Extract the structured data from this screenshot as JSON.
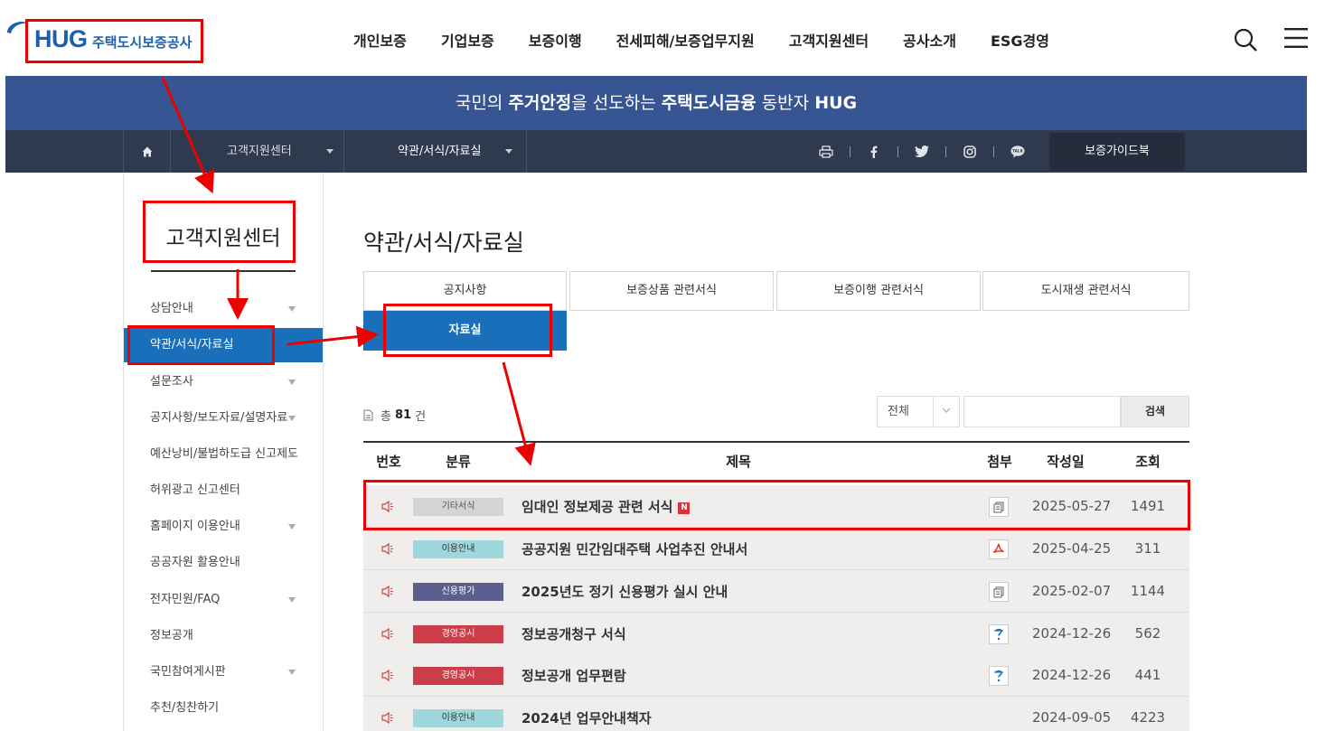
{
  "header": {
    "logo_brand": "HUG",
    "logo_name": "주택도시보증공사",
    "nav": [
      "개인보증",
      "기업보증",
      "보증이행",
      "전세피해/보증업무지원",
      "고객지원센터",
      "공사소개",
      "ESG경영"
    ]
  },
  "banner": {
    "part1": "국민의 ",
    "bold1": "주거안정",
    "part2": "을 선도하는 ",
    "bold2": "주택도시금융",
    "part3": " 동반자 ",
    "bold3": "HUG"
  },
  "location": {
    "depth1": "고객지원센터",
    "depth2": "약관/서식/자료실",
    "guidebook": "보증가이드북"
  },
  "sidebar": {
    "title": "고객지원센터",
    "items": [
      {
        "label": "상담안내",
        "has_arrow": true
      },
      {
        "label": "약관/서식/자료실",
        "active": true
      },
      {
        "label": "설문조사",
        "has_arrow": true
      },
      {
        "label": "공지사항/보도자료/설명자료",
        "has_arrow": true
      },
      {
        "label": "예산낭비/불법하도급 신고제도",
        "has_arrow": true
      },
      {
        "label": "허위광고 신고센터"
      },
      {
        "label": "홈페이지 이용안내",
        "has_arrow": true
      },
      {
        "label": "공공자원 활용안내"
      },
      {
        "label": "전자민원/FAQ",
        "has_arrow": true
      },
      {
        "label": "정보공개"
      },
      {
        "label": "국민참여게시판",
        "has_arrow": true
      },
      {
        "label": "추천/칭찬하기"
      }
    ]
  },
  "main": {
    "title": "약관/서식/자료실",
    "tabs": [
      "공지사항",
      "보증상품 관련서식",
      "보증이행 관련서식",
      "도시재생 관련서식",
      "자료실"
    ],
    "active_tab": "자료실",
    "total_prefix": "총",
    "total_count": "81",
    "total_suffix": "건",
    "search_select": "전체",
    "search_button": "검색",
    "columns": [
      "번호",
      "분류",
      "제목",
      "첨부",
      "작성일",
      "조회"
    ],
    "rows": [
      {
        "category": "기타서식",
        "cat_color": "#d4d4d4",
        "cat_text_color": "#555555",
        "title": "임대인 정보제공 관련 서식",
        "new": "N",
        "attach": "file",
        "date": "2025-05-27",
        "views": "1491"
      },
      {
        "category": "이용안내",
        "cat_color": "#9fd8dc",
        "cat_text_color": "#333333",
        "title": "공공지원 민간임대주택 사업추진 안내서",
        "attach": "pdf",
        "date": "2025-04-25",
        "views": "311"
      },
      {
        "category": "신용평가",
        "cat_color": "#5c5f8e",
        "cat_text_color": "#ffffff",
        "title": "2025년도 정기 신용평가 실시 안내",
        "attach": "file",
        "date": "2025-02-07",
        "views": "1144"
      },
      {
        "category": "경영공시",
        "cat_color": "#cb3d49",
        "cat_text_color": "#ffffff",
        "title": "정보공개청구 서식",
        "attach": "hwp",
        "date": "2024-12-26",
        "views": "562"
      },
      {
        "category": "경영공시",
        "cat_color": "#cb3d49",
        "cat_text_color": "#ffffff",
        "title": "정보공개 업무편람",
        "attach": "hwp",
        "date": "2024-12-26",
        "views": "441"
      },
      {
        "category": "이용안내",
        "cat_color": "#9fd8dc",
        "cat_text_color": "#333333",
        "title": "2024년 업무안내책자",
        "attach": "",
        "date": "2024-09-05",
        "views": "4223"
      }
    ]
  },
  "colors": {
    "brand_blue": "#1b5fb0",
    "banner": "#375592",
    "active": "#1a6fba",
    "annotation_red": "#ee0000"
  }
}
